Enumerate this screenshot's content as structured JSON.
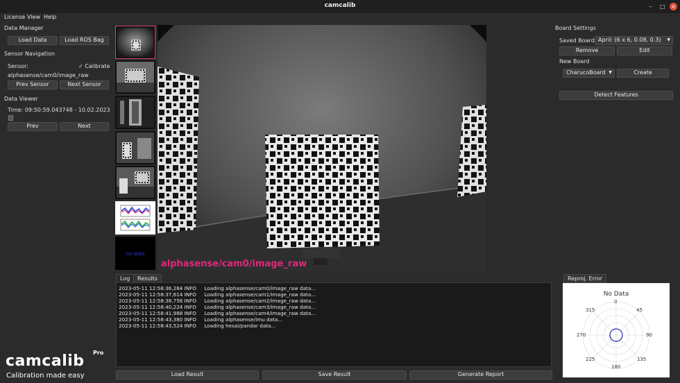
{
  "window": {
    "title": "camcalib"
  },
  "menu": [
    "License",
    "View",
    "Help"
  ],
  "data_manager": {
    "heading": "Data Manager",
    "load_data": "Load Data",
    "load_ros_bag": "Load ROS Bag"
  },
  "sensor_nav": {
    "heading": "Sensor Navigation",
    "sensor_label": "Sensor:",
    "calibrate_label": "Calibrate",
    "calibrate_checked": true,
    "sensor_value": "alphasense/cam0/image_raw",
    "prev_sensor": "Prev Sensor",
    "next_sensor": "Next Sensor"
  },
  "data_viewer": {
    "heading": "Data Viewer",
    "time": "Time: 09:50:59.043748 - 10.02.2023",
    "prev": "Prev",
    "next": "Next"
  },
  "thumbnails": {
    "no_data": "no data"
  },
  "main_image": {
    "caption": "alphasense/cam0/image_raw",
    "caption_color": "#e3277a"
  },
  "tabs": {
    "log": "Log",
    "results": "Results"
  },
  "log_lines": [
    "2023-05-11 12:58:36,284 INFO     Loading alphasense/cam0/image_raw data...",
    "2023-05-11 12:58:37,614 INFO     Loading alphasense/cam1/image_raw data...",
    "2023-05-11 12:58:38,756 INFO     Loading alphasense/cam2/image_raw data...",
    "2023-05-11 12:58:40,224 INFO     Loading alphasense/cam3/image_raw data...",
    "2023-05-11 12:58:41,988 INFO     Loading alphasense/cam4/image_raw data...",
    "2023-05-11 12:58:43,380 INFO     Loading alphasense/imu data...",
    "2023-05-11 12:58:43,524 INFO     Loading hesai/pandar data..."
  ],
  "bottom_buttons": {
    "load_result": "Load Result",
    "save_result": "Save Result",
    "generate_report": "Generate Report"
  },
  "board": {
    "heading": "Board Settings",
    "saved_label": "Saved Boards:",
    "saved_value": "April: (6 x 6, 0.08, 0.3)",
    "remove": "Remove",
    "edit": "Edit",
    "new_board": "New Board",
    "board_type": "CharucoBoard",
    "create": "Create",
    "detect": "Detect Features"
  },
  "reproj": {
    "tab": "Reproj. Error",
    "no_data": "No Data",
    "angles": [
      "0",
      "45",
      "90",
      "135",
      "180",
      "225",
      "270",
      "315"
    ]
  },
  "brand": {
    "name": "camcalib",
    "pro": "Pro",
    "tagline": "Calibration made easy"
  }
}
